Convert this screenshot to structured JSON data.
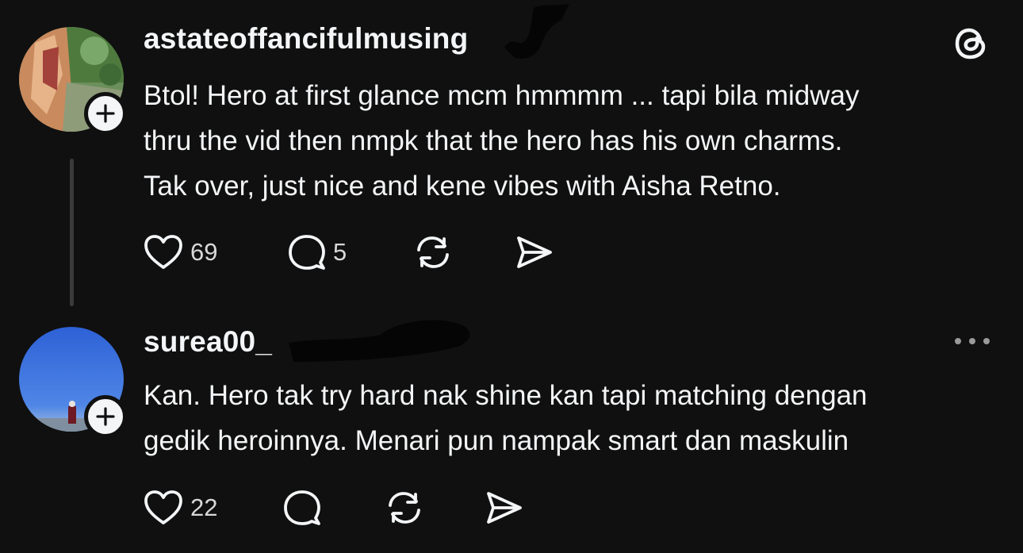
{
  "brand": {
    "logo_icon": "threads-logo-icon"
  },
  "posts": [
    {
      "username": "astateoffancifulmusing",
      "text_lines": [
        "Btol! Hero at first glance mcm hmmmm ... tapi bila midway",
        "thru the vid then nmpk that the hero has his own charms.",
        "Tak over, just nice and kene vibes with Aisha Retno."
      ],
      "likes": "69",
      "replies": "5"
    },
    {
      "username": "surea00_",
      "text_lines": [
        "Kan. Hero tak try hard nak shine kan tapi matching dengan",
        "gedik heroinnya. Menari pun nampak smart dan maskulin"
      ],
      "likes": "22",
      "replies": ""
    }
  ],
  "icons": {
    "like": "heart-icon",
    "reply": "comment-icon",
    "repost": "repost-icon",
    "share": "send-icon",
    "follow": "plus-icon",
    "more": "more-dots-icon"
  },
  "colors": {
    "background": "#101010",
    "text": "#f3f5f7",
    "muted": "#d8d8d8",
    "thread_line": "#3a3a3a"
  }
}
